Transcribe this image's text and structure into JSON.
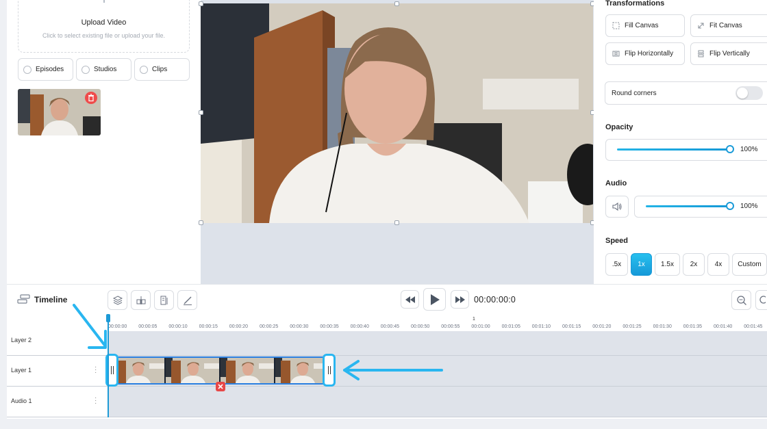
{
  "left_panel": {
    "upload_title": "Upload Video",
    "upload_subtitle": "Click to select existing file or upload your file.",
    "filters": [
      "Episodes",
      "Studios",
      "Clips"
    ]
  },
  "right_panel": {
    "transformations_label": "Transformations",
    "fill_canvas": "Fill Canvas",
    "fit_canvas": "Fit Canvas",
    "flip_horizontally": "Flip Horizontally",
    "flip_vertically": "Flip Vertically",
    "round_corners": "Round corners",
    "round_corners_enabled": false,
    "opacity_label": "Opacity",
    "opacity_value": "100%",
    "opacity_level": 1.0,
    "audio_label": "Audio",
    "audio_value": "100%",
    "audio_level": 1.0,
    "speed_label": "Speed",
    "speeds": [
      ".5x",
      "1x",
      "1.5x",
      "2x",
      "4x",
      "Custom"
    ],
    "selected_speed": "1x"
  },
  "timeline": {
    "title": "Timeline",
    "time": "00:00:00:0",
    "marker": "1",
    "ticks": [
      "00:00:00",
      "00:00:05",
      "00:00:10",
      "00:00:15",
      "00:00:20",
      "00:00:25",
      "00:00:30",
      "00:00:35",
      "00:00:40",
      "00:00:45",
      "00:00:50",
      "00:00:55",
      "00:01:00",
      "00:01:05",
      "00:01:10",
      "00:01:15",
      "00:01:20",
      "00:01:25",
      "00:01:30",
      "00:01:35",
      "00:01:40",
      "00:01:45"
    ],
    "layers": [
      "Layer 2",
      "Layer 1",
      "Audio 1"
    ],
    "tools": [
      "layers-icon",
      "split-icon",
      "shuffle-icon",
      "pen-icon"
    ]
  },
  "colors": {
    "accent": "#1d9ad6",
    "annotation": "#29b6f0",
    "danger": "#e74848"
  }
}
